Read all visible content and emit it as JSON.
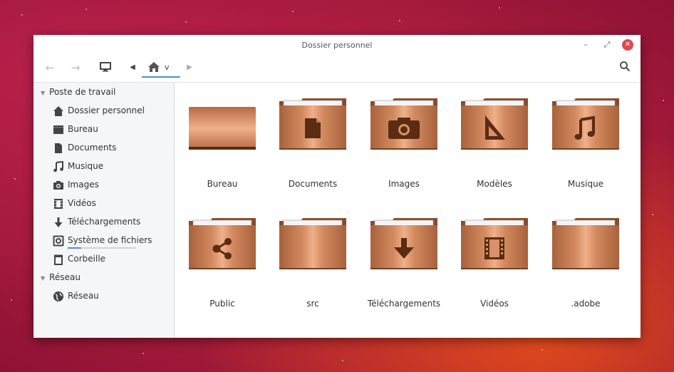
{
  "window": {
    "title": "Dossier personnel",
    "minimize_glyph": "–",
    "maximize_glyph": "⤢",
    "close_glyph": "✕"
  },
  "toolbar": {
    "back_glyph": "←",
    "forward_glyph": "→",
    "pathbar_left_glyph": "◀",
    "pathbar_right_glyph": "▶",
    "breadcrumb_label": "v",
    "breadcrumb_icon": "home-icon",
    "search_icon": "search-icon"
  },
  "sidebar": {
    "sections": [
      {
        "title": "Poste de travail",
        "items": [
          {
            "label": "Dossier personnel",
            "icon": "home-icon"
          },
          {
            "label": "Bureau",
            "icon": "desktop-icon"
          },
          {
            "label": "Documents",
            "icon": "document-icon"
          },
          {
            "label": "Musique",
            "icon": "music-icon"
          },
          {
            "label": "Images",
            "icon": "camera-icon"
          },
          {
            "label": "Vidéos",
            "icon": "film-icon"
          },
          {
            "label": "Téléchargements",
            "icon": "download-icon"
          },
          {
            "label": "Système de fichiers",
            "icon": "drive-icon",
            "usage_fraction": 0.2
          },
          {
            "label": "Corbeille",
            "icon": "trash-icon"
          }
        ]
      },
      {
        "title": "Réseau",
        "items": [
          {
            "label": "Réseau",
            "icon": "network-icon"
          }
        ]
      }
    ]
  },
  "files": [
    {
      "name": "Bureau",
      "icon": "desktop-folder-icon"
    },
    {
      "name": "Documents",
      "icon": "documents-folder-icon"
    },
    {
      "name": "Images",
      "icon": "pictures-folder-icon"
    },
    {
      "name": "Modèles",
      "icon": "templates-folder-icon"
    },
    {
      "name": "Musique",
      "icon": "music-folder-icon"
    },
    {
      "name": "Public",
      "icon": "public-folder-icon"
    },
    {
      "name": "src",
      "icon": "folder-icon"
    },
    {
      "name": "Téléchargements",
      "icon": "downloads-folder-icon"
    },
    {
      "name": "Vidéos",
      "icon": "videos-folder-icon"
    },
    {
      "name": ".adobe",
      "icon": "folder-icon"
    }
  ],
  "colors": {
    "accent": "#4a90d9",
    "close_button": "#e0474c",
    "folder_copper_light": "#e9a27a",
    "folder_copper_dark": "#a8623c",
    "folder_glyph": "#5a2c14"
  }
}
